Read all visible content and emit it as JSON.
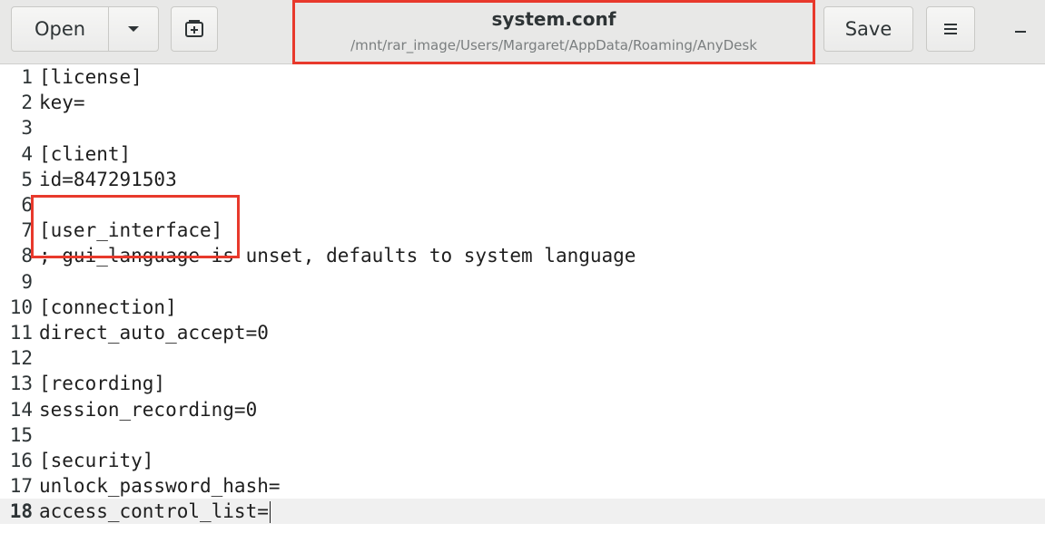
{
  "toolbar": {
    "open_label": "Open",
    "save_label": "Save"
  },
  "title": {
    "filename": "system.conf",
    "path": "/mnt/rar_image/Users/Margaret/AppData/Roaming/AnyDesk"
  },
  "editor": {
    "current_line": 18,
    "lines": [
      {
        "num": "1",
        "text": "[license]"
      },
      {
        "num": "2",
        "text": "key="
      },
      {
        "num": "3",
        "text": ""
      },
      {
        "num": "4",
        "text": "[client]"
      },
      {
        "num": "5",
        "text": "id=847291503"
      },
      {
        "num": "6",
        "text": ""
      },
      {
        "num": "7",
        "text": "[user_interface]"
      },
      {
        "num": "8",
        "text": "; gui_language is unset, defaults to system language"
      },
      {
        "num": "9",
        "text": ""
      },
      {
        "num": "10",
        "text": "[connection]"
      },
      {
        "num": "11",
        "text": "direct_auto_accept=0"
      },
      {
        "num": "12",
        "text": ""
      },
      {
        "num": "13",
        "text": "[recording]"
      },
      {
        "num": "14",
        "text": "session_recording=0"
      },
      {
        "num": "15",
        "text": ""
      },
      {
        "num": "16",
        "text": "[security]"
      },
      {
        "num": "17",
        "text": "unlock_password_hash="
      },
      {
        "num": "18",
        "text": "access_control_list="
      }
    ]
  },
  "icons": {
    "open_menu": "chevron-down-icon",
    "new_document": "new-document-icon",
    "hamburger": "hamburger-menu-icon",
    "minimize": "minimize-icon"
  },
  "colors": {
    "annotation_box": "#e8392c",
    "headerbar": "#e8e8e7",
    "current_line": "#f0f0f0"
  }
}
